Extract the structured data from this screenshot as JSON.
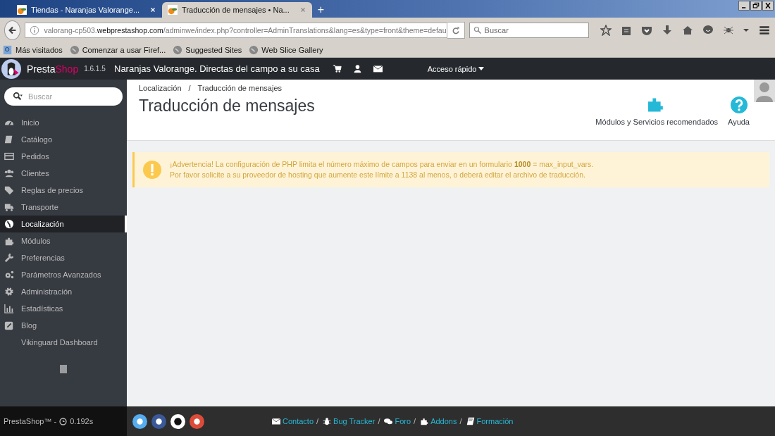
{
  "browser": {
    "tabs": [
      {
        "title": "Tiendas - Naranjas Valorange...",
        "selected": false
      },
      {
        "title": "Traducción de mensajes • Na...",
        "selected": true
      }
    ],
    "new_tab": "+",
    "url": {
      "prefix": "valorang-cp503.",
      "domain": "webprestashop.com",
      "path": "/adminwe/index.php?controller=AdminTranslations&lang=es&type=front&theme=defau"
    },
    "search": {
      "placeholder": "Buscar"
    },
    "bookmarks": [
      "Más visitados",
      "Comenzar a usar Firef...",
      "Suggested Sites",
      "Web Slice Gallery"
    ]
  },
  "header": {
    "logo_a": "Presta",
    "logo_b": "Shop",
    "version": "1.6.1.5",
    "shop_name": "Naranjas Valorange. Directas del campo a su casa",
    "quick_access": "Acceso rápido"
  },
  "sidebar": {
    "search": {
      "placeholder": "Buscar"
    },
    "items": [
      {
        "label": "Inicio",
        "selected": false
      },
      {
        "label": "Catálogo",
        "selected": false
      },
      {
        "label": "Pedidos",
        "selected": false
      },
      {
        "label": "Clientes",
        "selected": false
      },
      {
        "label": "Reglas de precios",
        "selected": false
      },
      {
        "label": "Transporte",
        "selected": false
      },
      {
        "label": "Localización",
        "selected": true
      },
      {
        "label": "Módulos",
        "selected": false
      },
      {
        "label": "Preferencias",
        "selected": false
      },
      {
        "label": "Parámetros Avanzados",
        "selected": false
      },
      {
        "label": "Administración",
        "selected": false
      },
      {
        "label": "Estadísticas",
        "selected": false
      },
      {
        "label": "Blog",
        "selected": false
      },
      {
        "label": "Vikinguard Dashboard",
        "selected": false
      }
    ]
  },
  "breadcrumb": {
    "items": [
      "Localización",
      "Traducción de mensajes"
    ],
    "separator": "/"
  },
  "page_title": "Traducción de mensajes",
  "toolbar": [
    {
      "label": "Módulos y Servicios recomendados"
    },
    {
      "label": "Ayuda"
    }
  ],
  "alert": {
    "lines": [
      "¡Advertencia! La configuración de PHP limita el número máximo de campos para enviar en un formulario **1000** = max_input_vars.",
      "Por favor solicite a su proveedor de hosting que aumente este límite a 1138 al menos, o deberá editar el archivo de traducción."
    ]
  },
  "footer": {
    "brand": "PrestaShop™ -",
    "time": "0.192s",
    "links": [
      {
        "label": "Contacto",
        "after": "/"
      },
      {
        "label": "Bug Tracker",
        "after": "/"
      },
      {
        "label": "Foro",
        "after": "/"
      },
      {
        "label": "Addons",
        "after": "/"
      },
      {
        "label": "Formación"
      }
    ]
  }
}
